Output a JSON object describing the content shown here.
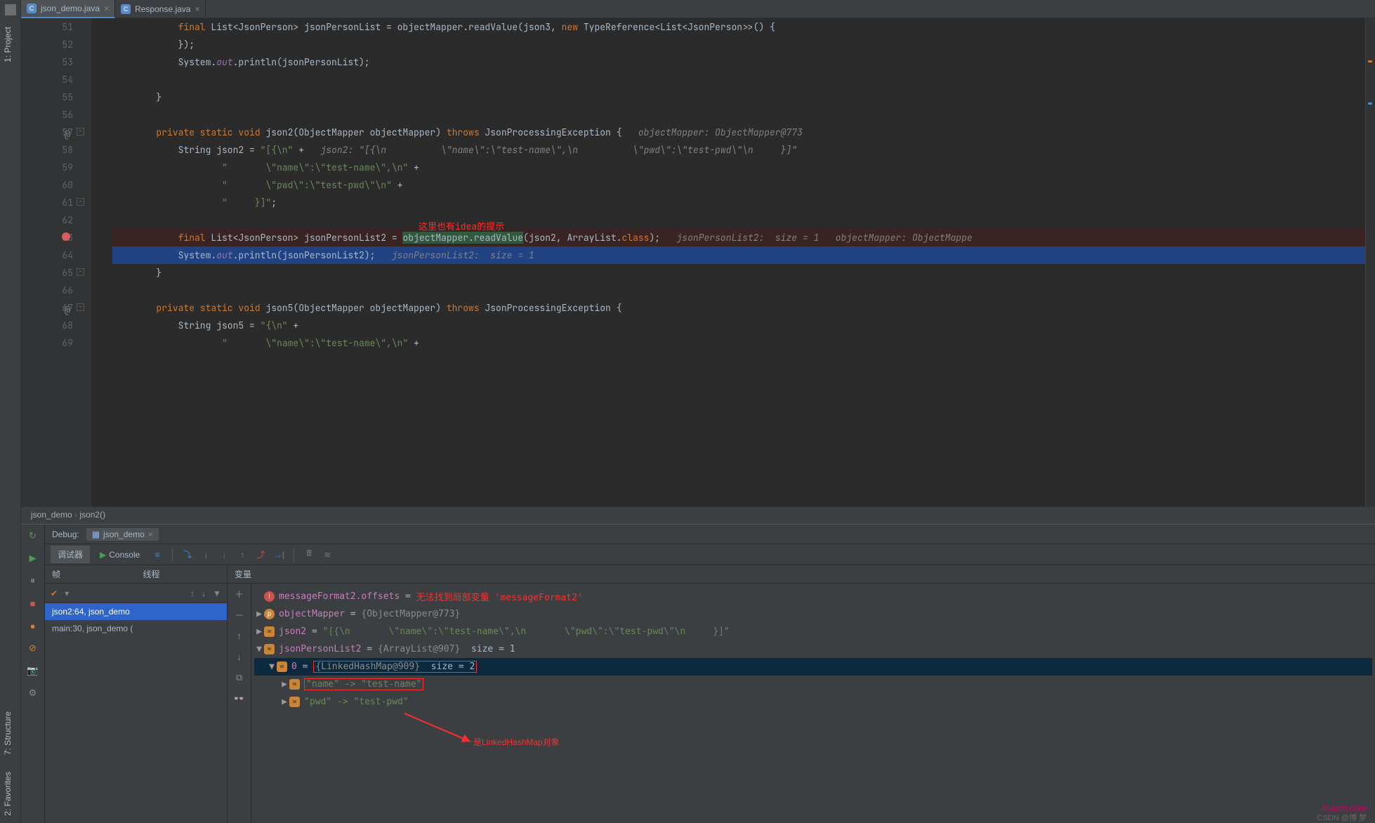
{
  "leftRail": {
    "project": "1: Project",
    "structure": "7: Structure",
    "favorites": "2: Favorites"
  },
  "tabs": [
    {
      "name": "json_demo.java",
      "active": true
    },
    {
      "name": "Response.java",
      "active": false
    }
  ],
  "annotations": {
    "top": "这里也有idea的提示",
    "bottom": "是LinkedHashMap对象"
  },
  "code": {
    "lines": [
      {
        "n": 51,
        "html": "            <span class='kw'>final</span> List&lt;JsonPerson&gt; jsonPersonList = objectMapper.readValue(json3, <span class='kw'>new</span> TypeReference&lt;List&lt;JsonPerson&gt;&gt;() {"
      },
      {
        "n": 52,
        "html": "            });"
      },
      {
        "n": 53,
        "html": "            System.<span class='field'>out</span>.println(jsonPersonList);"
      },
      {
        "n": 54,
        "html": ""
      },
      {
        "n": 55,
        "html": "        }"
      },
      {
        "n": 56,
        "html": ""
      },
      {
        "n": 57,
        "mk": "@",
        "fold": "-",
        "html": "        <span class='kw'>private static void</span> json2(ObjectMapper objectMapper) <span class='kw'>throws</span> JsonProcessingException {   <span class='cmt'>objectMapper: ObjectMapper@773</span>"
      },
      {
        "n": 58,
        "html": "            String json2 = <span class='str'>\"[{\\n\"</span> +   <span class='cmt'>json2: \"[{\\n          \\\"name\\\":\\\"test-name\\\",\\n          \\\"pwd\\\":\\\"test-pwd\\\"\\n     }]\"</span>"
      },
      {
        "n": 59,
        "html": "                    <span class='str'>\"       \\\"name\\\":\\\"test-name\\\",\\n\"</span> +"
      },
      {
        "n": 60,
        "html": "                    <span class='str'>\"       \\\"pwd\\\":\\\"test-pwd\\\"\\n\"</span> +"
      },
      {
        "n": 61,
        "fold": "-",
        "html": "                    <span class='str'>\"     }]\"</span>;"
      },
      {
        "n": 62,
        "html": ""
      },
      {
        "n": 63,
        "bp": true,
        "cls": "bpline",
        "html": "            <span class='kw'>final</span> List&lt;JsonPerson&gt; jsonPersonList2 = <span class='hl'>objectMapper.readValue</span>(json2, ArrayList.<span class='kw'>class</span>);   <span class='cmt'>jsonPersonList2:  size = 1   objectMapper: ObjectMappe</span>"
      },
      {
        "n": 64,
        "cls": "sel",
        "html": "            System.<span class='field'>out</span>.println(jsonPersonList2);   <span class='cmt'>jsonPersonList2:  size = 1</span>"
      },
      {
        "n": 65,
        "fold": "-",
        "html": "        }"
      },
      {
        "n": 66,
        "html": ""
      },
      {
        "n": 67,
        "mk": "@",
        "fold": "-",
        "html": "        <span class='kw'>private static void</span> json5(ObjectMapper objectMapper) <span class='kw'>throws</span> JsonProcessingException {"
      },
      {
        "n": 68,
        "html": "            String json5 = <span class='str'>\"{\\n\"</span> +"
      },
      {
        "n": 69,
        "html": "                    <span class='str'>\"       \\\"name\\\":\\\"test-name\\\",\\n\"</span> +"
      }
    ],
    "crumbs": [
      "json_demo",
      "json2()"
    ]
  },
  "debug": {
    "title": "Debug:",
    "runConfig": "json_demo",
    "tabs": {
      "debugger": "调试器",
      "console": "Console"
    },
    "frames": {
      "hdr1": "帧",
      "hdr2": "线程",
      "items": [
        {
          "label": "json2:64, json_demo",
          "sel": true
        },
        {
          "label": "main:30, json_demo ("
        }
      ]
    },
    "vars": {
      "hdr": "变量",
      "tree": [
        {
          "ind": 0,
          "arrow": "",
          "badge": "err",
          "name": "messageFormat2.offsets",
          "eq": " = ",
          "val": "无法找到局部变量 'messageFormat2'",
          "valcls": "ann-red"
        },
        {
          "ind": 0,
          "arrow": "▶",
          "badge": "p",
          "name": "objectMapper",
          "eq": " = ",
          "val": "{ObjectMapper@773}",
          "valcls": "vval"
        },
        {
          "ind": 0,
          "arrow": "▶",
          "badge": "f",
          "name": "json2",
          "eq": " = ",
          "val": "\"[{\\n       \\\"name\\\":\\\"test-name\\\",\\n       \\\"pwd\\\":\\\"test-pwd\\\"\\n     }]\"",
          "valcls": "vstr"
        },
        {
          "ind": 0,
          "arrow": "▼",
          "badge": "f",
          "name": "jsonPersonList2",
          "eq": " = ",
          "val": "{ArrayList@907}",
          "valcls": "vval",
          "extra": "  size = 1"
        },
        {
          "ind": 1,
          "arrow": "▼",
          "badge": "f",
          "name": "0",
          "eq": " = ",
          "val": "{LinkedHashMap@909}",
          "valcls": "vval",
          "extra": "  size = 2",
          "sel": true,
          "box": true
        },
        {
          "ind": 2,
          "arrow": "▶",
          "badge": "f",
          "name": "",
          "eq": "",
          "val": "\"name\" -> \"test-name\"",
          "valcls": "vstr",
          "box2": true
        },
        {
          "ind": 2,
          "arrow": "▶",
          "badge": "f",
          "name": "",
          "eq": "",
          "val": "\"pwd\" -> \"test-pwd\"",
          "valcls": "vstr"
        }
      ]
    }
  },
  "watermark": "Yuucn.com",
  "csdn": "CSDN @博 梦"
}
